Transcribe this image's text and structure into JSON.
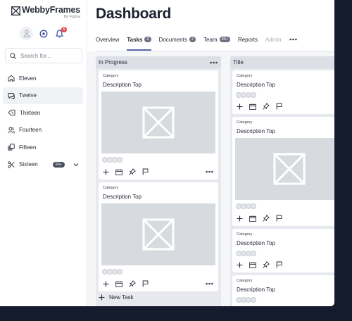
{
  "brand": {
    "name": "WebbyFrames",
    "sub": "for Figma"
  },
  "notifications": {
    "count": "5"
  },
  "search": {
    "placeholder": "Search for..."
  },
  "sidebar": {
    "items": [
      {
        "label": "Eleven",
        "icon": "home-icon"
      },
      {
        "label": "Twelve",
        "icon": "chat-icon"
      },
      {
        "label": "Thirteen",
        "icon": "tag-icon"
      },
      {
        "label": "Fourteen",
        "icon": "users-icon"
      },
      {
        "label": "Fifteen",
        "icon": "layers-icon"
      },
      {
        "label": "Sixteen",
        "icon": "scissors-icon",
        "badge": "99+"
      }
    ],
    "active_index": 1
  },
  "page": {
    "title": "Dashboard"
  },
  "tabs": [
    {
      "label": "Overview"
    },
    {
      "label": "Tasks",
      "badge": "2",
      "active": true
    },
    {
      "label": "Documents",
      "badge": "2"
    },
    {
      "label": "Team",
      "badge": "99+"
    },
    {
      "label": "Reports"
    },
    {
      "label": "Admin",
      "disabled": true
    }
  ],
  "columns": [
    {
      "title": "In Progress",
      "cards": [
        {
          "category": "Category",
          "description": "Description Top"
        },
        {
          "category": "Category",
          "description": "Description Top"
        }
      ],
      "new_task_label": "New Task"
    },
    {
      "title": "Title",
      "cards": [
        {
          "category": "Category",
          "description": "Description Top"
        },
        {
          "category": "Category",
          "description": "Description Top"
        },
        {
          "category": "Category",
          "description": "Description Top"
        },
        {
          "category": "Category",
          "description": "Description Top"
        }
      ]
    }
  ],
  "colors": {
    "accent": "#5b6aa8",
    "badge_red": "#e5484d",
    "board_bg": "#f5f6f8",
    "column_bg": "#e7e9ee",
    "placeholder": "#d7dadf",
    "desktop_bg": "#141b2d"
  }
}
